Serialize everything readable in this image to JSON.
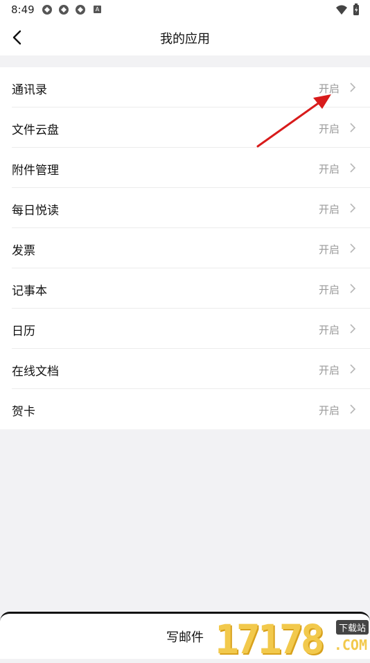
{
  "status_bar": {
    "time": "8:49",
    "badge": "A"
  },
  "header": {
    "title": "我的应用"
  },
  "items": [
    {
      "label": "通讯录",
      "status": "开启"
    },
    {
      "label": "文件云盘",
      "status": "开启"
    },
    {
      "label": "附件管理",
      "status": "开启"
    },
    {
      "label": "每日悦读",
      "status": "开启"
    },
    {
      "label": "发票",
      "status": "开启"
    },
    {
      "label": "记事本",
      "status": "开启"
    },
    {
      "label": "日历",
      "status": "开启"
    },
    {
      "label": "在线文档",
      "status": "开启"
    },
    {
      "label": "贺卡",
      "status": "开启"
    }
  ],
  "bottom": {
    "compose_label": "写邮件"
  },
  "watermark": {
    "digits": "17178",
    "badge": "下载站",
    "suffix": ".COM"
  },
  "colors": {
    "annotation_arrow": "#d81b1b",
    "status_text": "#9a9a9a",
    "watermark": "#f2c94c"
  }
}
